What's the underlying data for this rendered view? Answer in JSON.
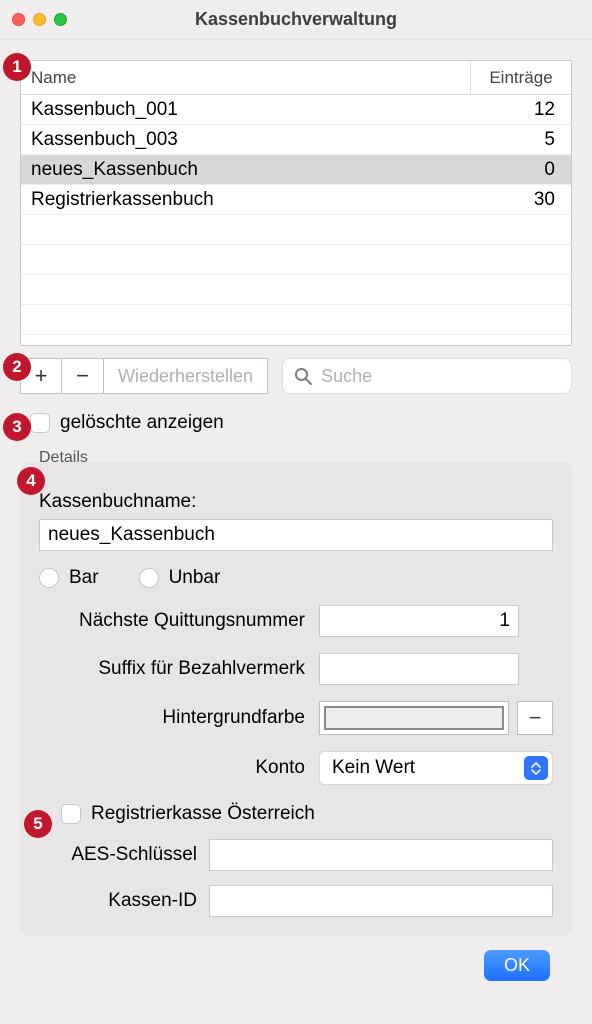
{
  "window": {
    "title": "Kassenbuchverwaltung"
  },
  "table": {
    "headers": {
      "name": "Name",
      "entries": "Einträge"
    },
    "rows": [
      {
        "name": "Kassenbuch_001",
        "entries": "12",
        "selected": false
      },
      {
        "name": "Kassenbuch_003",
        "entries": "5",
        "selected": false
      },
      {
        "name": "neues_Kassenbuch",
        "entries": "0",
        "selected": true
      },
      {
        "name": "Registrierkassenbuch",
        "entries": "30",
        "selected": false
      }
    ]
  },
  "toolbar": {
    "add": "+",
    "remove": "−",
    "restore": "Wiederherstellen",
    "search_placeholder": "Suche"
  },
  "show_deleted_label": "gelöschte anzeigen",
  "details": {
    "legend": "Details",
    "name_label": "Kassenbuchname:",
    "name_value": "neues_Kassenbuch",
    "radio_bar": "Bar",
    "radio_unbar": "Unbar",
    "next_receipt_label": "Nächste Quittungsnummer",
    "next_receipt_value": "1",
    "suffix_label": "Suffix für Bezahlvermerk",
    "suffix_value": "",
    "bgcolor_label": "Hintergrundfarbe",
    "account_label": "Konto",
    "account_value": "Kein Wert",
    "austria_label": "Registrierkasse Österreich",
    "aes_label": "AES-Schlüssel",
    "aes_value": "",
    "kassen_id_label": "Kassen-ID",
    "kassen_id_value": ""
  },
  "ok_label": "OK",
  "callouts": [
    "1",
    "2",
    "3",
    "4",
    "5"
  ]
}
